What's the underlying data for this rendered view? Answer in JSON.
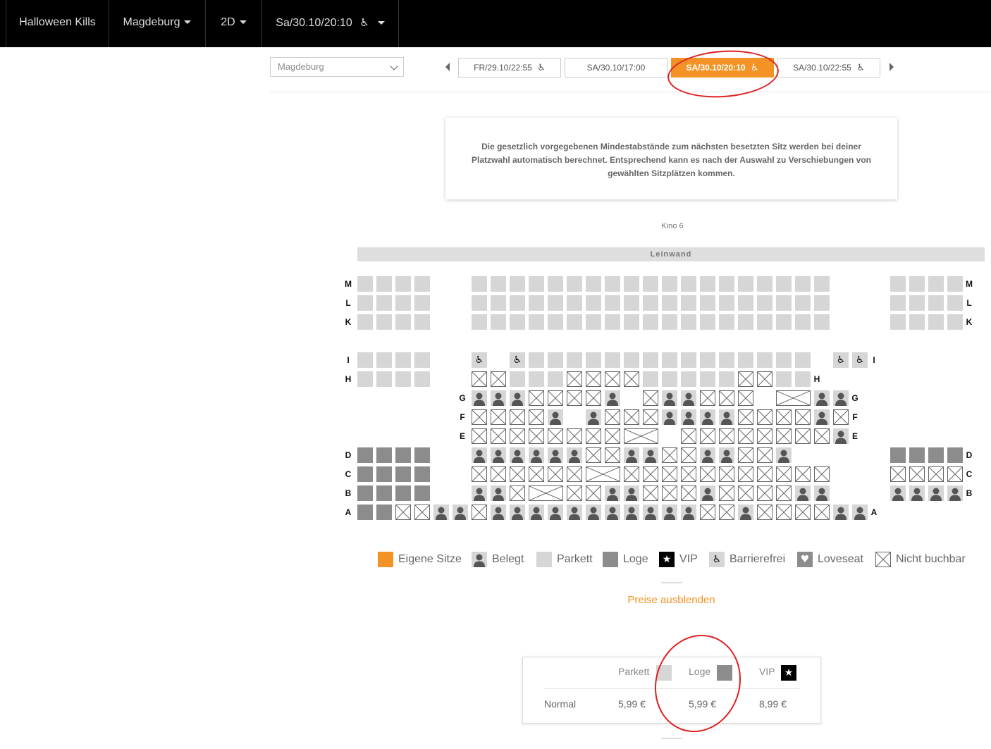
{
  "topnav": {
    "movie_title": "Halloween Kills",
    "city": "Magdeburg",
    "format": "2D",
    "showtime": "Sa/30.10/20:10"
  },
  "city_select": {
    "value": "Magdeburg"
  },
  "showtimes": [
    {
      "label": "FR/29.10/22:55",
      "accessible": true,
      "active": false
    },
    {
      "label": "SA/30.10/17:00",
      "accessible": false,
      "active": false
    },
    {
      "label": "SA/30.10/20:10",
      "accessible": true,
      "active": true
    },
    {
      "label": "SA/30.10/22:55",
      "accessible": true,
      "active": false
    }
  ],
  "notice": "Die gesetzlich vorgegebenen Mindestabstände zum nächsten besetzten Sitz werden bei deiner Platzwahl automatisch berechnet. Entsprechend kann es nach der Auswahl zu Verschiebungen von gewählten Sitzplätzen kommen.",
  "hall_name": "Kino 6",
  "screen_label": "Leinwand",
  "seat_rows": {
    "M": "pppp_ppppppppppppppppppp_pppp",
    "L": "pppp_ppppppppppppppppppp_pppp",
    "K": "pppp_ppppppppppppppppppp_pppp",
    "I": "pppp_w_wppppppppppppppp_ww",
    "H": "pppp_xxpppxxxxpppppxxpp",
    "G": "bbbxxxxbxbbxxxXbbxx",
    "F": "xxxxbbxxxbbbbxxxxbxx",
    "E": "xxxxxxxxXxxxxxxxxbxx",
    "D": "llll_bbbbbbxxbbxxbbxxb_llll",
    "C": "llll_xxxxxxXxxxxxxxxxxx_xxxx",
    "B": "llll_bbxXxxbbxxxbxxxxbb_bbbb",
    "A": "llxxbbxxxxbbbbbbbbxxbxxxxbb_xbbb"
  },
  "legend": {
    "own": "Eigene Sitze",
    "occupied": "Belegt",
    "parkett": "Parkett",
    "loge": "Loge",
    "vip": "VIP",
    "accessible": "Barrierefrei",
    "loveseat": "Loveseat",
    "unavailable": "Nicht buchbar"
  },
  "price_toggle": "Preise ausblenden",
  "prices": {
    "headers": [
      "Parkett",
      "Loge",
      "VIP"
    ],
    "row_label": "Normal",
    "values": [
      "5,99 €",
      "5,99 €",
      "8,99 €"
    ]
  },
  "colors": {
    "accent": "#f39325",
    "parkett": "#d6d6d6",
    "loge": "#8c8c8c",
    "annotation": "#e02020"
  },
  "icons": {
    "accessible": "wheelchair-icon",
    "occupied": "person-icon",
    "vip": "star-icon",
    "loveseat": "heart-icon",
    "unavailable": "cross-box-icon"
  }
}
